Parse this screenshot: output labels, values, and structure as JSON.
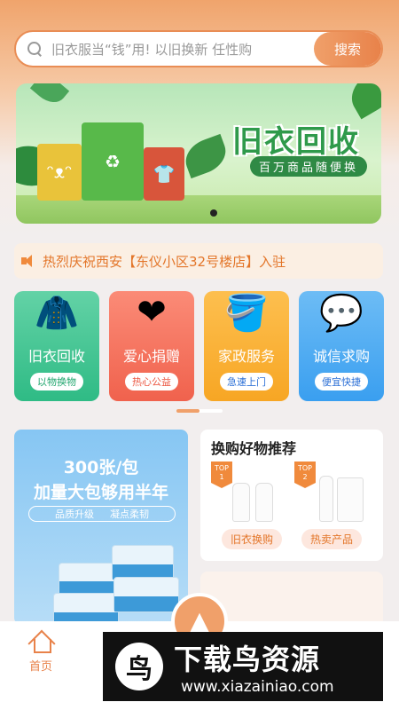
{
  "search": {
    "placeholder": "旧衣服当“钱”用! 以旧换新 任性购",
    "button": "搜索"
  },
  "banner": {
    "title": "旧衣回收",
    "subtitle": "百万商品随便换"
  },
  "notice": {
    "text": "热烈庆祝西安【东仪小区32号楼店】入驻"
  },
  "categories": [
    {
      "label": "旧衣回收",
      "tag": "以物换物",
      "icon": "hoodie-icon"
    },
    {
      "label": "爱心捐赠",
      "tag": "热心公益",
      "icon": "heart-box-icon"
    },
    {
      "label": "家政服务",
      "tag": "急速上门",
      "icon": "cleaning-bucket-icon"
    },
    {
      "label": "诚信求购",
      "tag": "便宜快捷",
      "icon": "chat-bubble-icon"
    }
  ],
  "promo": {
    "line1": "300张/包",
    "line2": "加量大包够用半年",
    "feature1": "品质升级",
    "feature2": "凝点柔韧"
  },
  "recommend": {
    "title": "换购好物推荐",
    "badge1": "TOP\n1",
    "badge2": "TOP\n2",
    "pill1": "旧衣换购",
    "pill2": "热卖产品"
  },
  "nav": {
    "home": "首页"
  },
  "watermark": {
    "title": "下载鸟资源",
    "url": "www.xiazainiao.com"
  },
  "colors": {
    "accent": "#e8824a",
    "green": "#2fbb85",
    "red": "#f0624d",
    "yellow": "#f7a624",
    "blue": "#3a9ff0"
  }
}
